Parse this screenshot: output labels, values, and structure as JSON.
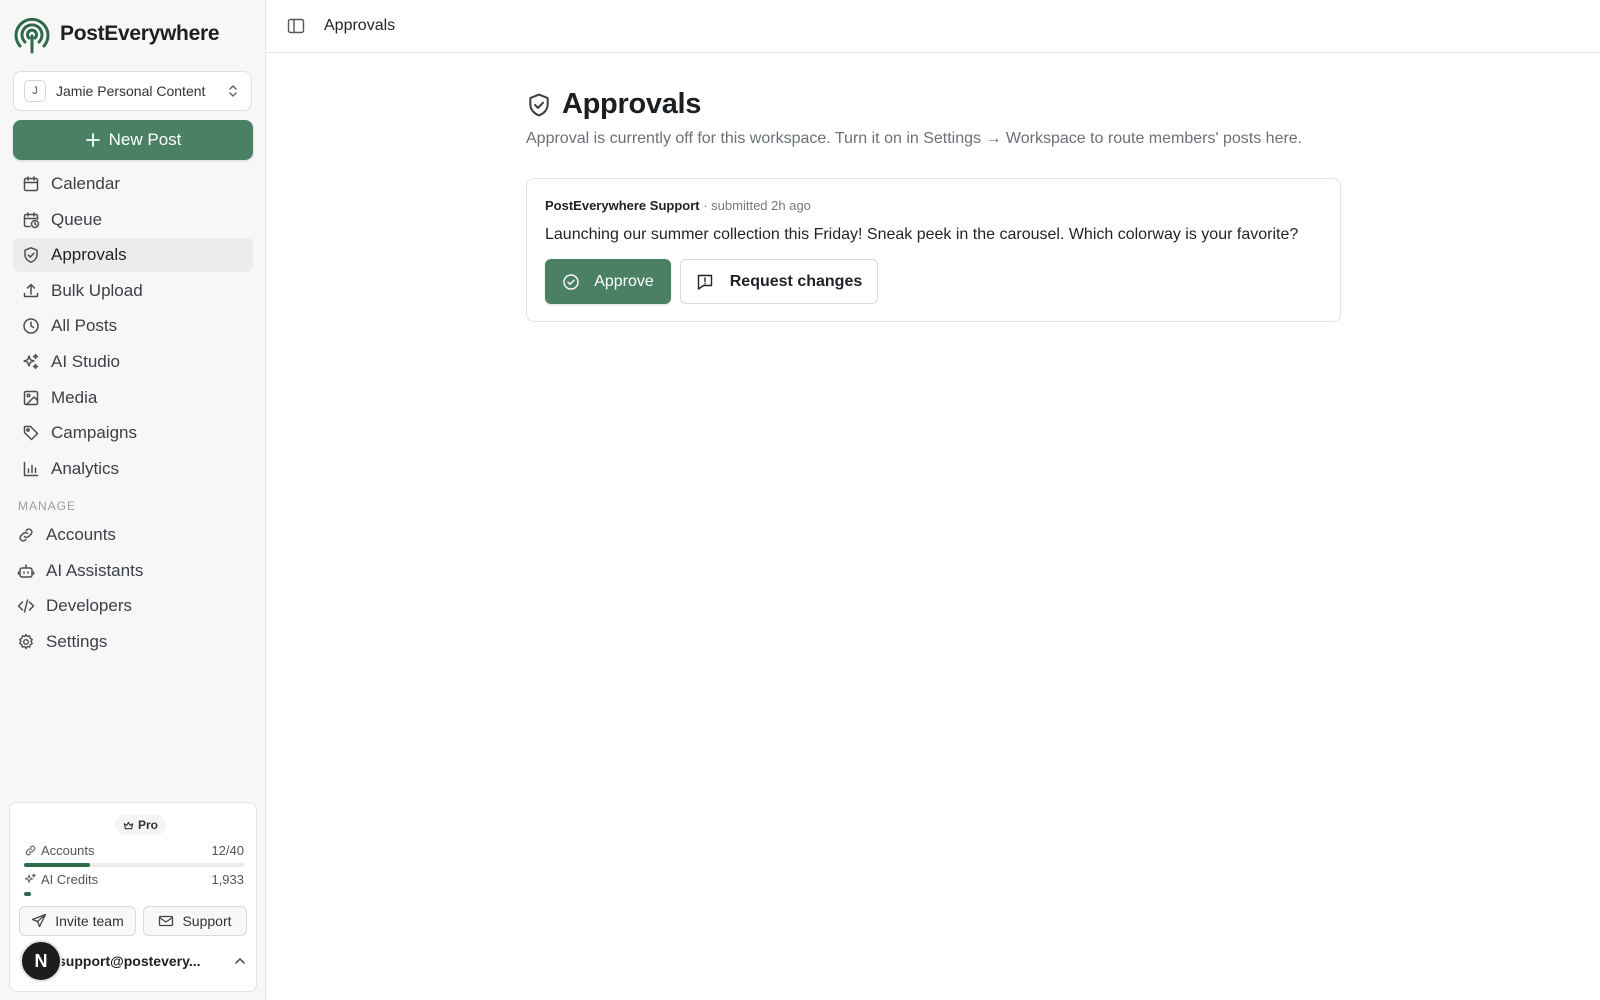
{
  "brand": {
    "name": "PostEverywhere",
    "logo_icon": "radar-logo-icon",
    "color": "#2f6a4a"
  },
  "workspace": {
    "initial": "J",
    "name": "Jamie Personal Content"
  },
  "new_post_label": "New Post",
  "nav": [
    {
      "label": "Calendar",
      "icon": "calendar-icon",
      "active": false
    },
    {
      "label": "Queue",
      "icon": "calendar-clock-icon",
      "active": false
    },
    {
      "label": "Approvals",
      "icon": "shield-check-icon",
      "active": true
    },
    {
      "label": "Bulk Upload",
      "icon": "upload-icon",
      "active": false
    },
    {
      "label": "All Posts",
      "icon": "clock-icon",
      "active": false
    },
    {
      "label": "AI Studio",
      "icon": "sparkles-icon",
      "active": false
    },
    {
      "label": "Media",
      "icon": "image-icon",
      "active": false
    },
    {
      "label": "Campaigns",
      "icon": "tag-icon",
      "active": false
    },
    {
      "label": "Analytics",
      "icon": "bar-chart-icon",
      "active": false
    }
  ],
  "manage": {
    "label": "MANAGE",
    "items": [
      {
        "label": "Accounts",
        "icon": "link-icon"
      },
      {
        "label": "AI Assistants",
        "icon": "bot-icon"
      },
      {
        "label": "Developers",
        "icon": "code-icon"
      },
      {
        "label": "Settings",
        "icon": "gear-icon"
      }
    ]
  },
  "plan": {
    "badge": "Pro",
    "accounts": {
      "label": "Accounts",
      "value": "12/40",
      "fraction": 0.3
    },
    "credits": {
      "label": "AI Credits",
      "value": "1,933",
      "fraction": 0.03
    },
    "invite_label": "Invite team",
    "support_label": "Support"
  },
  "user": {
    "avatar_initial": "N",
    "email": "support@postevery..."
  },
  "topbar": {
    "breadcrumb": "Approvals"
  },
  "page": {
    "title": "Approvals",
    "subtitle": "Approval is currently off for this workspace. Turn it on in Settings → Workspace to route members' posts here."
  },
  "approval_card": {
    "author": "PostEverywhere Support",
    "meta_sep": " · ",
    "submitted": "submitted 2h ago",
    "text": "Launching our summer collection this Friday! Sneak peek in the carousel. Which colorway is your favorite?",
    "approve_label": "Approve",
    "changes_label": "Request changes"
  },
  "colors": {
    "accent": "#4c8065",
    "sidebar_bg": "#f7f7f7",
    "active_bg": "#ececec"
  }
}
